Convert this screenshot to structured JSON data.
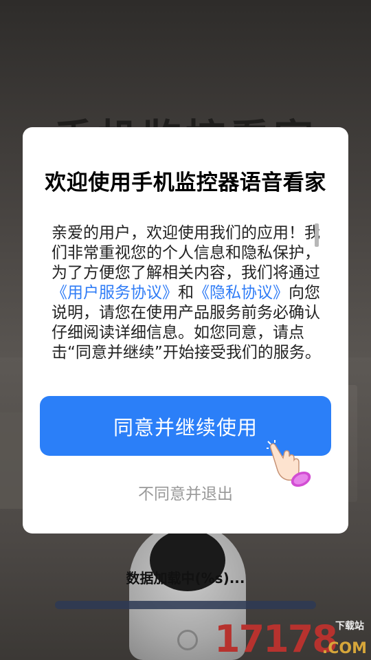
{
  "background": {
    "headline": "手机监控看家",
    "status_text": "数据加载中(%s)..."
  },
  "dialog": {
    "title": "欢迎使用手机监控器语音看家",
    "body": {
      "part1": "亲爱的用户，欢迎使用我们的应用！我们非常重视您的个人信息和隐私保护，为了方便您了解相关内容，我们将通过",
      "link_user_agreement": "《用户服务协议》",
      "and": "和",
      "link_privacy": "《隐私协议》",
      "part2": "向您说明，请您在使用产品服务前务必确认仔细阅读详细信息。如您同意，请点击“同意并继续”开始接受我们的服务。"
    },
    "agree_button": "同意并继续使用",
    "disagree_link": "不同意并退出"
  },
  "watermark": {
    "number": "17178",
    "domain": ".COM",
    "tag": "下载站"
  },
  "colors": {
    "primary": "#2b7ff8",
    "link": "#2f7cf6"
  },
  "icons": {
    "pointer": "hand-pointer-icon"
  }
}
